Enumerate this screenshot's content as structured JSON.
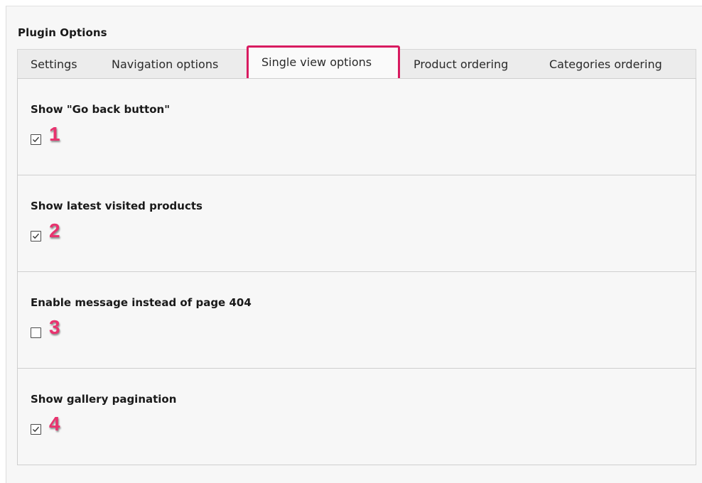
{
  "panel": {
    "title": "Plugin Options"
  },
  "tabs": [
    {
      "label": "Settings",
      "active": false
    },
    {
      "label": "Navigation options",
      "active": false
    },
    {
      "label": "Single view options",
      "active": true
    },
    {
      "label": "Product ordering",
      "active": false
    },
    {
      "label": "Categories ordering",
      "active": false
    }
  ],
  "options": [
    {
      "label": "Show \"Go back button\"",
      "checked": true,
      "annotation": "1"
    },
    {
      "label": "Show latest visited products",
      "checked": true,
      "annotation": "2"
    },
    {
      "label": "Enable message instead of page 404",
      "checked": false,
      "annotation": "3"
    },
    {
      "label": "Show gallery pagination",
      "checked": true,
      "annotation": "4"
    }
  ],
  "colors": {
    "active_tab_border": "#d81b60",
    "annotation": "#e8336f"
  }
}
